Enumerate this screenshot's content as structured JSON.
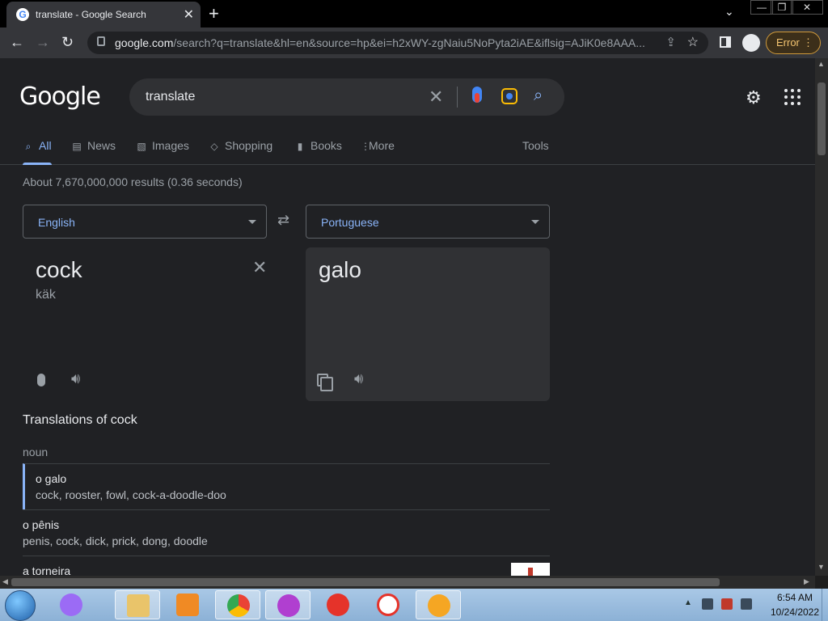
{
  "browser": {
    "tab_title": "translate - Google Search",
    "url_host": "google.com",
    "url_rest": "/search?q=translate&hl=en&source=hp&ei=h2xWY-zgNaiu5NoPyta2iAE&iflsig=AJiK0e8AAA...",
    "error_label": "Error"
  },
  "search": {
    "logo": "Google",
    "query": "translate"
  },
  "tabs": [
    {
      "label": "All",
      "icon": "search-icon"
    },
    {
      "label": "News",
      "icon": "news-icon"
    },
    {
      "label": "Images",
      "icon": "image-icon"
    },
    {
      "label": "Shopping",
      "icon": "tag-icon"
    },
    {
      "label": "Books",
      "icon": "book-icon"
    },
    {
      "label": "More",
      "icon": "more-dots-icon"
    }
  ],
  "tools_label": "Tools",
  "results_stats": "About 7,670,000,000 results (0.36 seconds)",
  "translator": {
    "source_lang": "English",
    "target_lang": "Portuguese",
    "source_text": "cock",
    "source_pron": "käk",
    "target_text": "galo"
  },
  "translations": {
    "heading": "Translations of cock",
    "part_of_speech": "noun",
    "rows": [
      {
        "word": "o galo",
        "synonyms": "cock, rooster, fowl, cock-a-doodle-doo"
      },
      {
        "word": "o pênis",
        "synonyms": "penis, cock, dick, prick, dong, doodle"
      },
      {
        "word": "a torneira",
        "synonyms": ""
      }
    ]
  },
  "taskbar": {
    "time": "6:54 AM",
    "date": "10/24/2022"
  },
  "colors": {
    "accent": "#8ab4f8",
    "background": "#202124",
    "error": "#f3c470"
  }
}
